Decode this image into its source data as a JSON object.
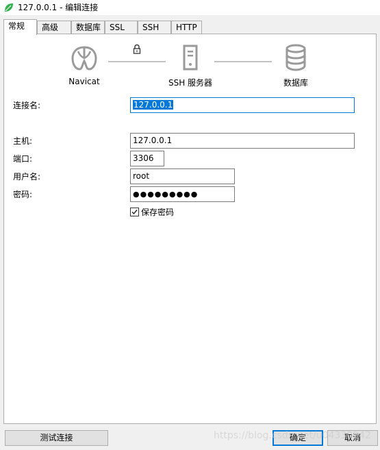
{
  "window": {
    "title": "127.0.0.1 - 编辑连接",
    "icon": "navicat-leaf-icon"
  },
  "tabs": [
    {
      "label": "常规",
      "active": true
    },
    {
      "label": "高级"
    },
    {
      "label": "数据库"
    },
    {
      "label": "SSL"
    },
    {
      "label": "SSH"
    },
    {
      "label": "HTTP"
    }
  ],
  "diagram": {
    "nodes": [
      {
        "label": "Navicat",
        "icon": "navicat-icon"
      },
      {
        "label": "SSH 服务器",
        "icon": "server-icon"
      },
      {
        "label": "数据库",
        "icon": "database-icon"
      }
    ],
    "lock_icon": "lock-icon"
  },
  "form": {
    "connection_name": {
      "label": "连接名:",
      "value": "127.0.0.1"
    },
    "host": {
      "label": "主机:",
      "value": "127.0.0.1"
    },
    "port": {
      "label": "端口:",
      "value": "3306"
    },
    "username": {
      "label": "用户名:",
      "value": "root"
    },
    "password": {
      "label": "密码:",
      "value": "●●●●●●●●●"
    },
    "save_password": {
      "label": "保存密码",
      "checked": true
    }
  },
  "buttons": {
    "test": "测试连接",
    "ok": "确定",
    "cancel": "取消"
  },
  "watermark": "https://blog.csdn.net/u04330942",
  "colors": {
    "accent": "#0078d7",
    "window_bg": "#f0f0f0"
  }
}
